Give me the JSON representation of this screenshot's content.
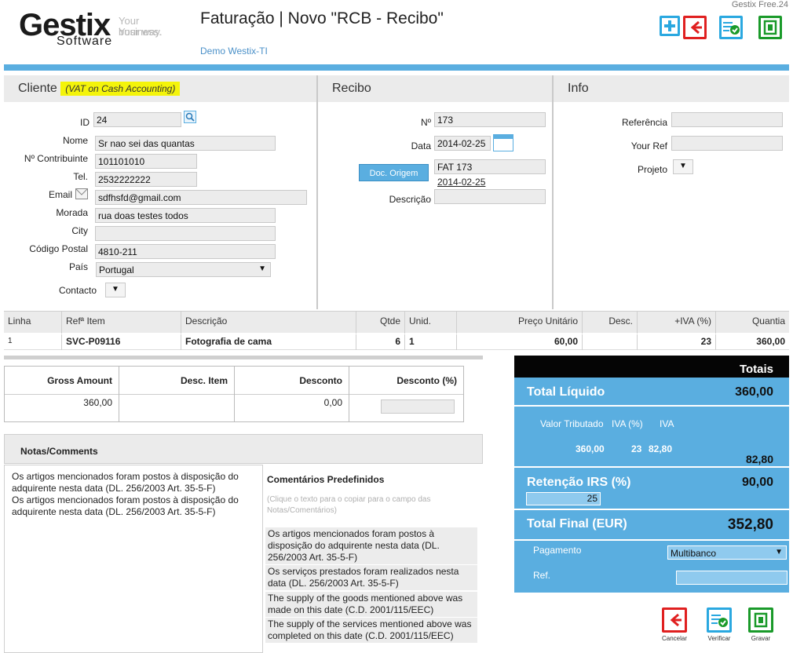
{
  "brand": {
    "name": "Gestix",
    "sub": "Software",
    "tag1": "Your business.",
    "tag2": "Your way.",
    "edition": "Gestix Free.24"
  },
  "page": {
    "title": "Faturação | Novo \"RCB - Recibo\"",
    "company": "Demo Westix-TI"
  },
  "cliente": {
    "heading": "Cliente",
    "vat_note": "(VAT on Cash Accounting)",
    "fields": {
      "id": {
        "label": "ID",
        "value": "24"
      },
      "nome": {
        "label": "Nome",
        "value": "Sr nao sei das quantas"
      },
      "contribuinte": {
        "label": "Nº Contribuinte",
        "value": "101101010"
      },
      "tel": {
        "label": "Tel.",
        "value": "2532222222"
      },
      "email": {
        "label": "Email",
        "value": "sdfhsfd@gmail.com"
      },
      "morada": {
        "label": "Morada",
        "value": "rua doas testes todos"
      },
      "city": {
        "label": "City",
        "value": ""
      },
      "codigo_postal": {
        "label": "Código Postal",
        "value": "4810-211"
      },
      "pais": {
        "label": "País",
        "value": "Portugal"
      },
      "contacto": {
        "label": "Contacto",
        "value": ""
      }
    }
  },
  "recibo": {
    "heading": "Recibo",
    "numero": {
      "label": "Nº",
      "value": "173"
    },
    "data": {
      "label": "Data",
      "value": "2014-02-25"
    },
    "doc_origem": {
      "button": "Doc. Origem",
      "value": "FAT 173",
      "date": "2014-02-25"
    },
    "descricao": {
      "label": "Descrição",
      "value": ""
    }
  },
  "info": {
    "heading": "Info",
    "referencia": {
      "label": "Referência",
      "value": ""
    },
    "your_ref": {
      "label": "Your Ref",
      "value": ""
    },
    "projeto": {
      "label": "Projeto",
      "value": ""
    }
  },
  "lines": {
    "headers": [
      "Linha",
      "Refª Item",
      "Descrição",
      "Qtde",
      "Unid.",
      "Preço Unitário",
      "Desc.",
      "+IVA (%)",
      "Quantia"
    ],
    "rows": [
      {
        "linha": "1",
        "ref": "SVC-P09116",
        "descricao": "Fotografia de cama",
        "qtde": "6",
        "unid": "1",
        "preco": "60,00",
        "desc": "",
        "iva": "23",
        "quantia": "360,00"
      }
    ]
  },
  "summary": {
    "headers": [
      "Gross Amount",
      "Desc. Item",
      "Desconto",
      "Desconto (%)"
    ],
    "values": [
      "360,00",
      "",
      "0,00",
      ""
    ]
  },
  "totais": {
    "heading": "Totais",
    "liquido_label": "Total Líquido",
    "liquido_value": "360,00",
    "tax_headers": [
      "Valor Tributado",
      "IVA (%)",
      "IVA"
    ],
    "tax_row": [
      "360,00",
      "23",
      "82,80"
    ],
    "iva_total": "82,80",
    "retencao_label": "Retenção IRS (%)",
    "retencao_value": "90,00",
    "retencao_pct": "25",
    "final_label": "Total Final (EUR)",
    "final_value": "352,80",
    "pagamento_label": "Pagamento",
    "pagamento_value": "Multibanco",
    "ref_label": "Ref.",
    "ref_value": ""
  },
  "notas": {
    "heading": "Notas/Comments",
    "text": [
      "Os artigos mencionados foram postos à disposição do adquirente nesta data (DL. 256/2003 Art. 35-5-F)",
      "Os artigos mencionados foram postos à disposição do adquirente nesta data (DL. 256/2003 Art. 35-5-F)"
    ]
  },
  "comentarios": {
    "heading": "Comentários Predefinidos",
    "hint": "(Clique o texto para o copiar para o campo das Notas/Comentários)",
    "items": [
      "Os artigos mencionados foram postos à disposição do adquirente nesta data (DL. 256/2003 Art. 35-5-F)",
      "Os serviços prestados foram realizados nesta data (DL. 256/2003 Art. 35-5-F)",
      "The supply of the goods mentioned above was made on this date (C.D. 2001/115/EEC)",
      "The supply of the services mentioned above was completed on this date (C.D. 2001/115/EEC)"
    ]
  },
  "actions": {
    "cancelar": "Cancelar",
    "verificar": "Verificar",
    "gravar": "Gravar"
  },
  "colors": {
    "accent_blue": "#5aaee0",
    "red": "#e02020",
    "green": "#1a9a2a",
    "highlight": "#f4f40a"
  }
}
